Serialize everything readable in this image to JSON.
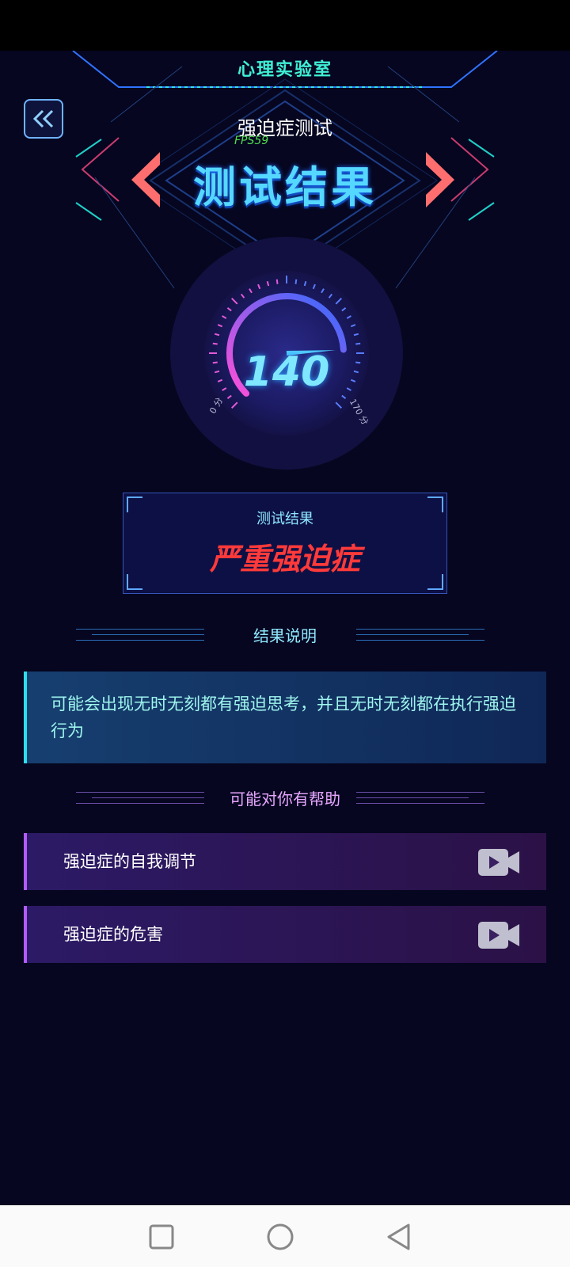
{
  "app": {
    "title": "心理实验室",
    "fps": "FPS59"
  },
  "header": {
    "test_name": "强迫症测试",
    "big_title": "测试结果",
    "back_icon": "double-chevron-left-icon"
  },
  "gauge": {
    "score": "140",
    "min_label": "0 分",
    "max_label": "170 分",
    "level_fraction": 0.82,
    "colors": {
      "arc_start": "#ff4fd8",
      "arc_end": "#2e6bff",
      "needle": "#4fc8ff"
    }
  },
  "result": {
    "label": "测试结果",
    "value": "严重强迫症",
    "value_color": "#ff3a3a"
  },
  "explanation": {
    "heading": "结果说明",
    "text": "可能会出现无时无刻都有强迫思考，并且无时无刻都在执行强迫行为"
  },
  "help": {
    "heading": "可能对你有帮助",
    "items": [
      {
        "label": "强迫症的自我调节",
        "icon": "video-play-icon"
      },
      {
        "label": "强迫症的危害",
        "icon": "video-play-icon"
      }
    ]
  },
  "navbar": {
    "icons": [
      "recent-apps-icon",
      "home-icon",
      "back-icon"
    ]
  }
}
